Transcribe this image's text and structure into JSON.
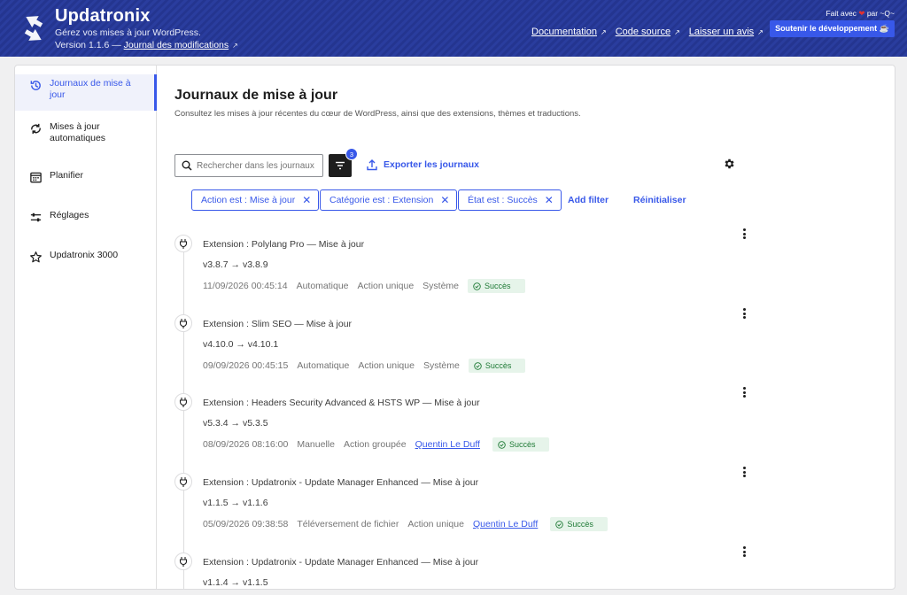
{
  "header": {
    "app_name": "Updatronix",
    "tagline": "Gérez vos mises à jour WordPress.",
    "version_prefix": "Version 1.1.6 — ",
    "changelog_label": "Journal des modifications",
    "links": [
      "Documentation",
      "Code source",
      "Laisser un avis"
    ],
    "made_with_prefix": "Fait avec",
    "made_with_suffix": "par ~Q~",
    "support_label": "Soutenir le développement ☕"
  },
  "sidebar": {
    "items": [
      {
        "label": "Journaux de mise à jour",
        "icon": "history-icon",
        "active": true
      },
      {
        "label": "Mises à jour automatiques",
        "icon": "sync-icon",
        "active": false
      },
      {
        "label": "Planifier",
        "icon": "calendar-icon",
        "active": false
      },
      {
        "label": "Réglages",
        "icon": "sliders-icon",
        "active": false
      },
      {
        "label": "Updatronix 3000",
        "icon": "star-icon",
        "active": false
      }
    ]
  },
  "main": {
    "title": "Journaux de mise à jour",
    "description": "Consultez les mises à jour récentes du cœur de WordPress, ainsi que des extensions, thèmes et traductions.",
    "search_placeholder": "Rechercher dans les journaux",
    "filter_count": "3",
    "export_label": "Exporter les journaux",
    "chips": [
      "Action est : Mise à jour",
      "Catégorie est : Extension",
      "État est : Succès"
    ],
    "add_filter": "Add filter",
    "reset": "Réinitialiser"
  },
  "logs": [
    {
      "title": "Extension : Polylang Pro — Mise à jour",
      "version": "v3.8.7 → v3.8.9",
      "date": "11/09/2026 00:45:14",
      "mode": "Automatique",
      "action": "Action unique",
      "user": "Système",
      "user_link": false,
      "status": "Succès"
    },
    {
      "title": "Extension : Slim SEO — Mise à jour",
      "version": "v4.10.0 → v4.10.1",
      "date": "09/09/2026 00:45:15",
      "mode": "Automatique",
      "action": "Action unique",
      "user": "Système",
      "user_link": false,
      "status": "Succès"
    },
    {
      "title": "Extension : Headers Security Advanced & HSTS WP — Mise à jour",
      "version": "v5.3.4 → v5.3.5",
      "date": "08/09/2026 08:16:00",
      "mode": "Manuelle",
      "action": "Action groupée",
      "user": "Quentin Le Duff",
      "user_link": true,
      "status": "Succès"
    },
    {
      "title": "Extension : Updatronix - Update Manager Enhanced — Mise à jour",
      "version": "v1.1.5 → v1.1.6",
      "date": "05/09/2026 09:38:58",
      "mode": "Téléversement de fichier",
      "action": "Action unique",
      "user": "Quentin Le Duff",
      "user_link": true,
      "status": "Succès"
    },
    {
      "title": "Extension : Updatronix - Update Manager Enhanced — Mise à jour",
      "version": "v1.1.4 → v1.1.5"
    }
  ]
}
